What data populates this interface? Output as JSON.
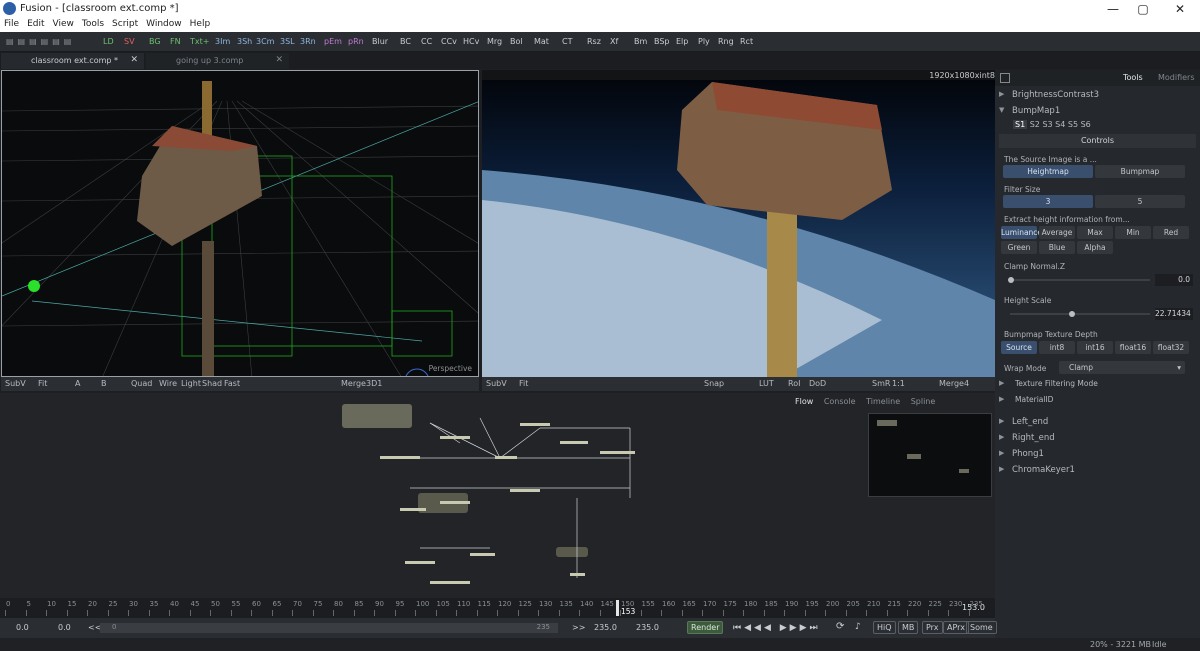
{
  "window": {
    "title": "Fusion - [classroom ext.comp *]",
    "minimize": "—",
    "maximize": "▢",
    "close": "✕"
  },
  "menu": [
    "File",
    "Edit",
    "View",
    "Tools",
    "Script",
    "Window",
    "Help"
  ],
  "toolbar": [
    {
      "label": "LD",
      "color": "#6fc06f"
    },
    {
      "label": "SV",
      "color": "#e06060"
    },
    {
      "label": "BG",
      "color": "#6fc06f"
    },
    {
      "label": "FN",
      "color": "#6fc06f"
    },
    {
      "label": "Txt+",
      "color": "#6fc06f"
    },
    {
      "label": "3Im",
      "color": "#8fb6e0"
    },
    {
      "label": "3Sh",
      "color": "#8fb6e0"
    },
    {
      "label": "3Cm",
      "color": "#8fb6e0"
    },
    {
      "label": "3SL",
      "color": "#8fb6e0"
    },
    {
      "label": "3Rn",
      "color": "#8fb6e0"
    },
    {
      "label": "pEm",
      "color": "#c27ad6"
    },
    {
      "label": "pRn",
      "color": "#c27ad6"
    },
    {
      "label": "Blur",
      "color": "#c9cdd2"
    },
    {
      "label": "BC",
      "color": "#c9cdd2"
    },
    {
      "label": "CC",
      "color": "#c9cdd2"
    },
    {
      "label": "CCv",
      "color": "#c9cdd2"
    },
    {
      "label": "HCv",
      "color": "#c9cdd2"
    },
    {
      "label": "Mrg",
      "color": "#c9cdd2"
    },
    {
      "label": "Bol",
      "color": "#c9cdd2"
    },
    {
      "label": "Mat",
      "color": "#c9cdd2"
    },
    {
      "label": "CT",
      "color": "#c9cdd2"
    },
    {
      "label": "Rsz",
      "color": "#c9cdd2"
    },
    {
      "label": "Xf",
      "color": "#c9cdd2"
    },
    {
      "label": "Bm",
      "color": "#c9cdd2"
    },
    {
      "label": "BSp",
      "color": "#c9cdd2"
    },
    {
      "label": "Elp",
      "color": "#c9cdd2"
    },
    {
      "label": "Ply",
      "color": "#c9cdd2"
    },
    {
      "label": "Rng",
      "color": "#c9cdd2"
    },
    {
      "label": "Rct",
      "color": "#c9cdd2"
    }
  ],
  "tabs": [
    {
      "label": "classroom ext.comp *"
    },
    {
      "label": "going up 3.comp"
    }
  ],
  "viewer_left": {
    "label": "Perspective",
    "subv": "SubV",
    "fit": "Fit",
    "a": "A",
    "b": "B",
    "quad": "Quad",
    "wire": "Wire",
    "light": "Light",
    "shad": "Shad",
    "fast": "Fast",
    "node": "Merge3D1"
  },
  "viewer_right": {
    "resolution": "1920x1080xint8",
    "subv": "SubV",
    "fit": "Fit",
    "snap": "Snap",
    "lut": "LUT",
    "roi": "RoI",
    "dod": "DoD",
    "smr": "SmR",
    "ratio": "1:1",
    "node": "Merge4"
  },
  "flow_tabs": [
    "Flow",
    "Console",
    "Timeline",
    "Spline"
  ],
  "panel": {
    "tabs": [
      "Tools",
      "Modifiers"
    ],
    "nodes_top": [
      "BrightnessContrast3",
      "BumpMap1"
    ],
    "slots": [
      "S1",
      "S2",
      "S3",
      "S4",
      "S5",
      "S6"
    ],
    "controls": "Controls",
    "source_label": "The Source Image is a ...",
    "source_opts": [
      "Heightmap",
      "Bumpmap"
    ],
    "filter_label": "Filter Size",
    "filter_opts": [
      "3",
      "5"
    ],
    "extract_label": "Extract height information from...",
    "extract_opts": [
      "Luminance",
      "Average",
      "Max",
      "Min",
      "Red",
      "Green",
      "Blue",
      "Alpha"
    ],
    "clamp_label": "Clamp Normal.Z",
    "clamp_val": "0.0",
    "height_label": "Height Scale",
    "height_val": "22.71434",
    "depth_label": "Bumpmap Texture Depth",
    "depth_opts": [
      "Source",
      "int8",
      "int16",
      "float16",
      "float32"
    ],
    "wrap_label": "Wrap Mode",
    "wrap_val": "Clamp",
    "tex_filter": "Texture Filtering Mode",
    "material": "MaterialID",
    "nodes_bottom": [
      "Left_end",
      "Right_end",
      "Phong1",
      "ChromaKeyer1"
    ]
  },
  "timeline": {
    "ticks": [
      "0",
      "5",
      "10",
      "15",
      "20",
      "25",
      "30",
      "35",
      "40",
      "45",
      "50",
      "55",
      "60",
      "65",
      "70",
      "75",
      "80",
      "85",
      "90",
      "95",
      "100",
      "105",
      "110",
      "115",
      "120",
      "125",
      "130",
      "135",
      "140",
      "145",
      "150",
      "155",
      "160",
      "165",
      "170",
      "175",
      "180",
      "185",
      "190",
      "195",
      "200",
      "205",
      "210",
      "215",
      "220",
      "225",
      "230",
      "235"
    ],
    "current": "153",
    "current_right": "153.0"
  },
  "transport": {
    "start": "0.0",
    "render_start": "0.0",
    "back": "<<",
    "range_start": "0",
    "range_end": "235",
    "fwd": ">>",
    "render_end": "235.0",
    "end": "235.0",
    "render": "Render",
    "hiq": "HiQ",
    "mb": "MB",
    "prx": "Prx",
    "aprx": "APrx",
    "some": "Some"
  },
  "status": {
    "memory": "20% - 3221 MB",
    "state": "Idle"
  }
}
